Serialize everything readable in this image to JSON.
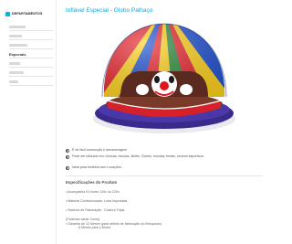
{
  "sidebar": {
    "header": "DEPARTAMENTOS",
    "active_item": "Especiais",
    "colors": {
      "accent": "#12aede"
    }
  },
  "main": {
    "title": "Inflável Especial - Globo Palhaço",
    "hero_image": "inflatable-clown-dome",
    "info": [
      "É de fácil locomoção e armazenagem",
      "Pode ser utilizado em: clínicas, escolas, Bufês, Clubes, escolas, festas, centros esportivos.",
      "Ideal para festinha com Locações."
    ],
    "specs_title": "Especificações do Produto",
    "specs": [
      "• Acompanha 01 motor 110v ou 220v.",
      "• Material Confeccionado: Lona importada.",
      "• Sistema de Fabricação : Costura Tripla",
      "(Podendo variar Cores)",
      "• Garantia de 12 Meses (para defeito de fabricação do Brinquedo)",
      "6 Meses para o Motor."
    ]
  }
}
